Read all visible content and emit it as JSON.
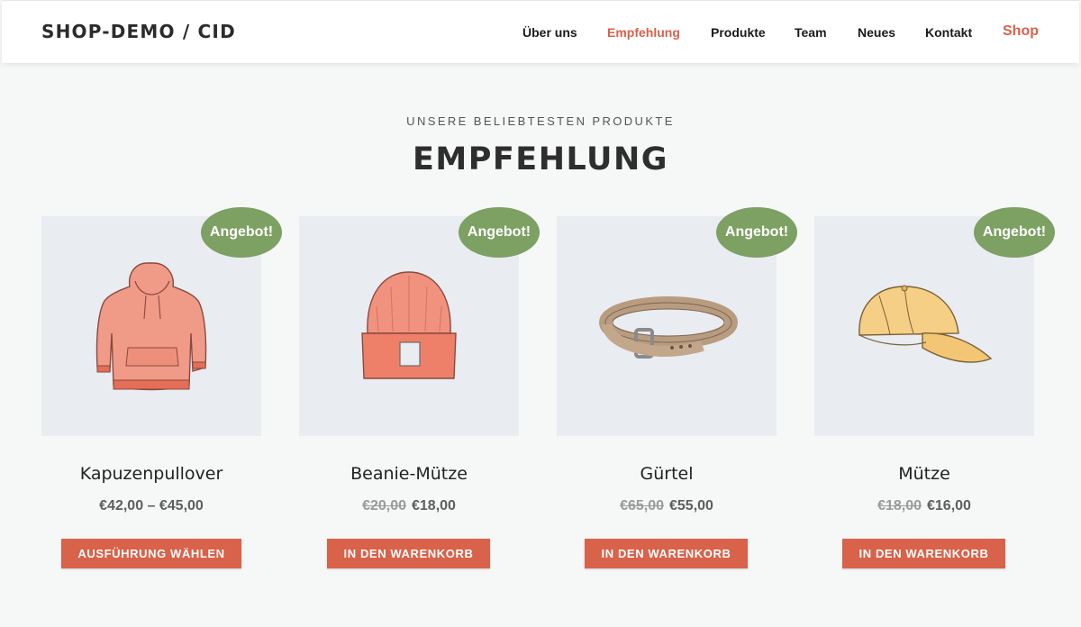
{
  "site": {
    "title": "SHOP-DEMO / CID"
  },
  "nav": {
    "items": [
      {
        "label": "Über uns"
      },
      {
        "label": "Empfehlung"
      },
      {
        "label": "Produkte"
      },
      {
        "label": "Team"
      },
      {
        "label": "Neues"
      },
      {
        "label": "Kontakt"
      },
      {
        "label": "Shop"
      }
    ],
    "active_item": "Empfehlung"
  },
  "section": {
    "subheading": "UNSERE BELIEBTESTEN PRODUKTE",
    "heading": "EMPFEHLUNG"
  },
  "products": [
    {
      "title": "Kapuzenpullover",
      "price_old": "",
      "price": "€42,00 – €45,00",
      "badge": "Angebot!",
      "button": "Ausführung wählen",
      "icon": "hoodie-icon"
    },
    {
      "title": "Beanie-Mütze",
      "price_old": "€20,00",
      "price": "€18,00",
      "badge": "Angebot!",
      "button": "In den Warenkorb",
      "icon": "beanie-icon"
    },
    {
      "title": "Gürtel",
      "price_old": "€65,00",
      "price": "€55,00",
      "badge": "Angebot!",
      "button": "In den Warenkorb",
      "icon": "belt-icon"
    },
    {
      "title": "Mütze",
      "price_old": "€18,00",
      "price": "€16,00",
      "badge": "Angebot!",
      "button": "In den Warenkorb",
      "icon": "cap-icon"
    }
  ],
  "colors": {
    "accent": "#d8624a",
    "badge": "#7da063",
    "image_background": "#e9ecf1",
    "page_background": "#f6f7f7"
  }
}
